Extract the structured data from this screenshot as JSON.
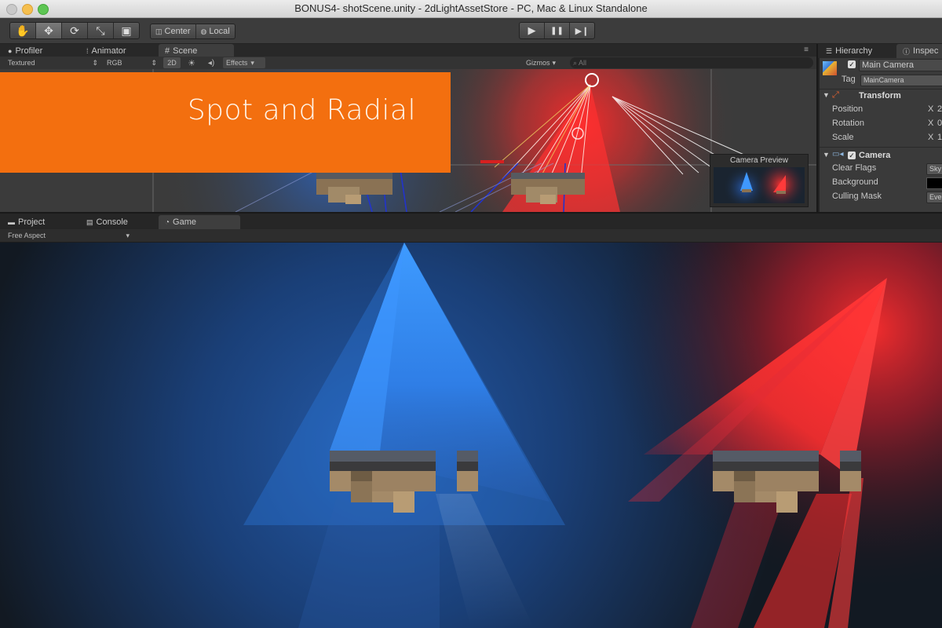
{
  "window": {
    "title": "BONUS4- shotScene.unity - 2dLightAssetStore - PC, Mac & Linux Standalone"
  },
  "toolbar": {
    "tools": [
      {
        "icon": "hand-icon",
        "glyph": "✋"
      },
      {
        "icon": "move-icon",
        "glyph": "✥"
      },
      {
        "icon": "rotate-icon",
        "glyph": "⟳"
      },
      {
        "icon": "scale-icon",
        "glyph": "⤡"
      },
      {
        "icon": "rect-icon",
        "glyph": "▣"
      }
    ],
    "pivot_label": "Center",
    "space_label": "Local",
    "play_glyph": "▶",
    "pause_glyph": "❚❚",
    "step_glyph": "▶❙"
  },
  "upper_tabs": {
    "profiler": "Profiler",
    "animator": "Animator",
    "scene": "Scene",
    "hierarchy": "Hierarchy",
    "inspector": "Inspec"
  },
  "scene_bar": {
    "shading": "Textured",
    "render_mode": "RGB",
    "mode_2d": "2D",
    "effects": "Effects",
    "gizmos": "Gizmos",
    "search_placeholder": "All"
  },
  "banner": {
    "text": "Spot and Radial"
  },
  "camera_preview": {
    "title": "Camera Preview"
  },
  "inspector": {
    "object_name": "Main Camera",
    "tag_label": "Tag",
    "tag_value": "MainCamera",
    "transform_title": "Transform",
    "position_label": "Position",
    "rotation_label": "Rotation",
    "scale_label": "Scale",
    "axis_label": "X",
    "position_x": "2",
    "rotation_x": "0",
    "scale_x": "1",
    "camera_title": "Camera",
    "clear_flags_label": "Clear Flags",
    "clear_flags_value": "Sky",
    "background_label": "Background",
    "culling_mask_label": "Culling Mask",
    "culling_mask_value": "Eve"
  },
  "lower_tabs": {
    "project": "Project",
    "console": "Console",
    "game": "Game",
    "aspect": "Free Aspect"
  },
  "colors": {
    "banner": "#f36f0f",
    "blue_light": "#2f8cff",
    "red_light": "#ff3535"
  }
}
